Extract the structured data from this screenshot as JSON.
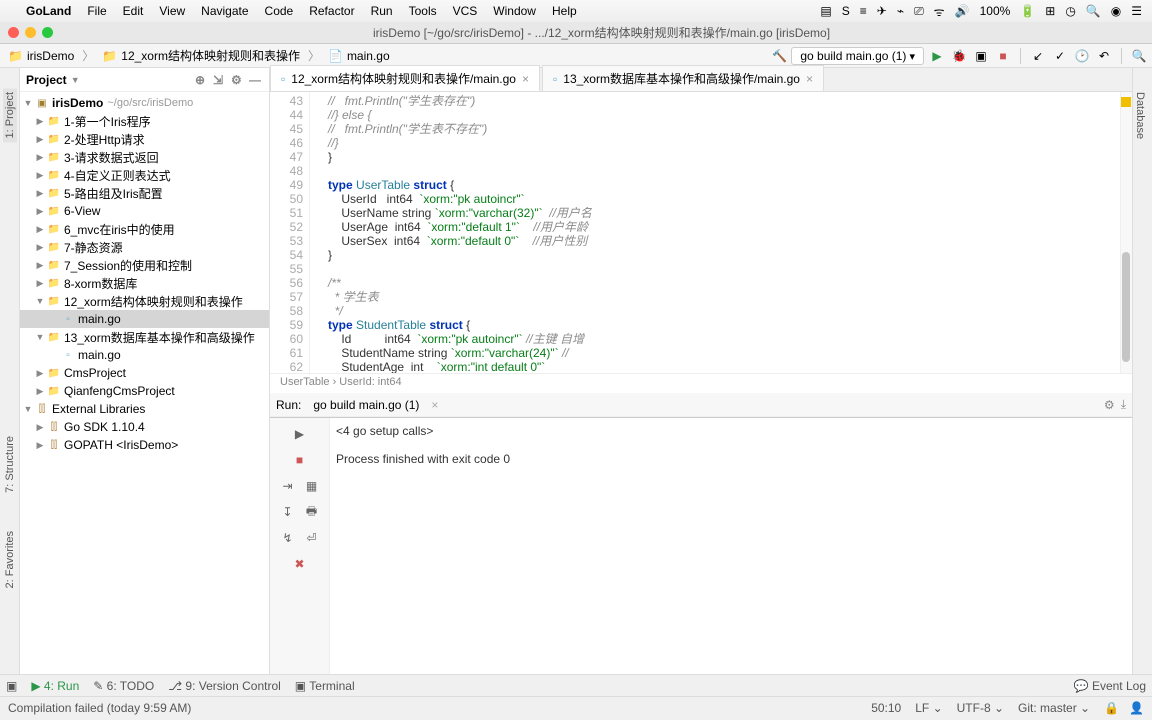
{
  "mac": {
    "app": "GoLand",
    "menus": [
      "File",
      "Edit",
      "View",
      "Navigate",
      "Code",
      "Refactor",
      "Run",
      "Tools",
      "VCS",
      "Window",
      "Help"
    ],
    "battery": "100%"
  },
  "window_title": "irisDemo [~/go/src/irisDemo] - .../12_xorm结构体映射规则和表操作/main.go [irisDemo]",
  "breadcrumb": {
    "a": "irisDemo",
    "b": "12_xorm结构体映射规则和表操作",
    "c": "main.go"
  },
  "run_config": "go build main.go (1)",
  "project": {
    "title": "Project"
  },
  "tree": {
    "root": "irisDemo",
    "root_path": "~/go/src/irisDemo",
    "items": [
      "1-第一个Iris程序",
      "2-处理Http请求",
      "3-请求数据式返回",
      "4-自定义正则表达式",
      "5-路由组及Iris配置",
      "6-View",
      "6_mvc在iris中的使用",
      "7-静态资源",
      "7_Session的使用和控制",
      "8-xorm数据库"
    ],
    "expanded1": "12_xorm结构体映射规则和表操作",
    "file1": "main.go",
    "expanded2": "13_xorm数据库基本操作和高级操作",
    "file2": "main.go",
    "other": [
      "CmsProject",
      "QianfengCmsProject"
    ],
    "ext": "External Libraries",
    "ext_items": [
      "Go SDK 1.10.4",
      "GOPATH <IrisDemo>"
    ]
  },
  "tabs": {
    "t1": "12_xorm结构体映射规则和表操作/main.go",
    "t2": "13_xorm数据库基本操作和高级操作/main.go"
  },
  "code": {
    "start": 43,
    "crumb": "UserTable  ›  UserId: int64"
  },
  "run": {
    "label": "Run:",
    "name": "go build main.go (1)",
    "l1": "<4 go setup calls>",
    "l2": "Process finished with exit code 0"
  },
  "bottom": {
    "b1": "4: Run",
    "b2": "6: TODO",
    "b3": "9: Version Control",
    "b4": "Terminal",
    "evt": "Event Log"
  },
  "status": {
    "msg": "Compilation failed (today 9:59 AM)",
    "pos": "50:10",
    "le": "LF",
    "enc": "UTF-8",
    "git": "Git: master"
  },
  "left_tabs": {
    "p": "1: Project",
    "s": "7: Structure",
    "f": "2: Favorites"
  },
  "right_tabs": {
    "db": "Database"
  }
}
